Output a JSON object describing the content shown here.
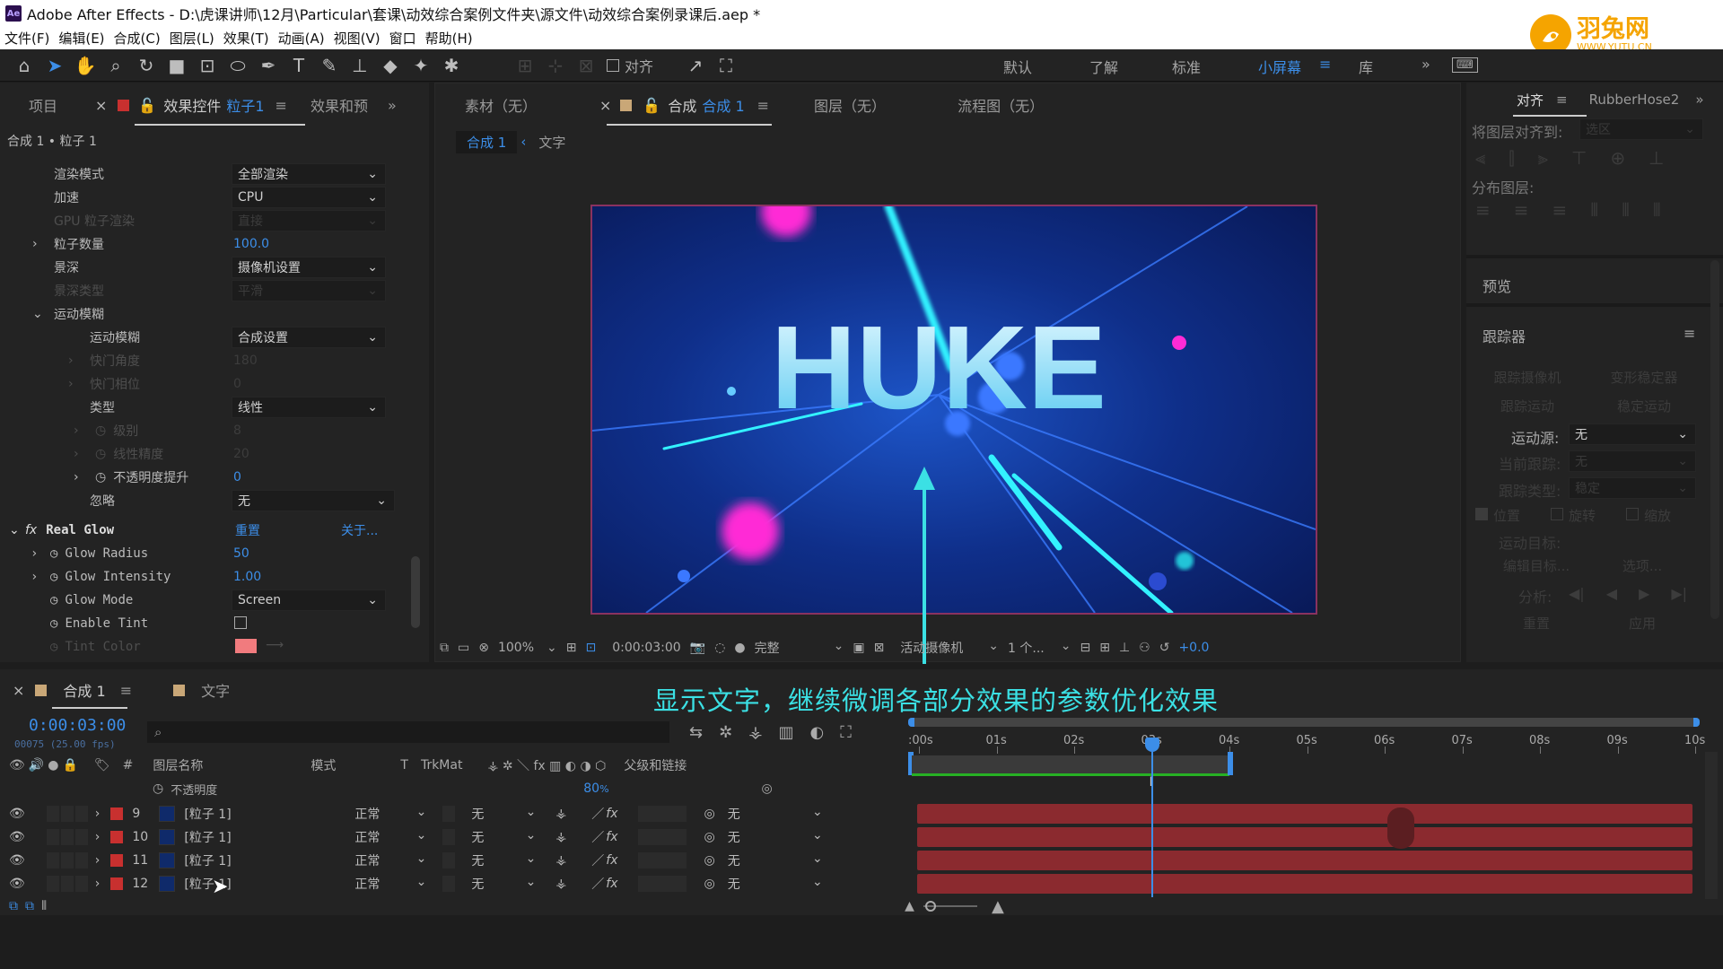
{
  "titlebar": {
    "app_icon": "Ae",
    "title": "Adobe After Effects - D:\\虎课讲师\\12月\\Particular\\套课\\动效综合案例文件夹\\源文件\\动效综合案例录课后.aep *"
  },
  "menu": [
    "文件(F)",
    "编辑(E)",
    "合成(C)",
    "图层(L)",
    "效果(T)",
    "动画(A)",
    "视图(V)",
    "窗口",
    "帮助(H)"
  ],
  "logo": {
    "name": "羽兔网",
    "url": "WWW.YUTU.CN",
    "color": "#f5a400"
  },
  "toolbar": {
    "align_label": "对齐",
    "workspaces": [
      "默认",
      "了解",
      "标准",
      "小屏幕",
      "库"
    ],
    "active_workspace": "小屏幕"
  },
  "left_panel": {
    "tabs": [
      "项目",
      "效果控件",
      "粒子1",
      "效果和预设"
    ],
    "tab_project": "项目",
    "tab_effects_prefix": "效果控件",
    "tab_effects_layer": "粒子1",
    "tab_presets": "效果和预",
    "breadcrumb": "合成 1 • 粒子 1",
    "rows": [
      {
        "label": "渲染模式",
        "value": "全部渲染",
        "type": "dropdown"
      },
      {
        "label": "加速",
        "value": "CPU",
        "type": "dropdown"
      },
      {
        "label": "GPU 粒子渲染",
        "value": "直接",
        "type": "dropdown-disabled"
      },
      {
        "label": "粒子数量",
        "value": "100.0",
        "type": "number"
      },
      {
        "label": "景深",
        "value": "摄像机设置",
        "type": "dropdown"
      },
      {
        "label": "景深类型",
        "value": "平滑",
        "type": "dropdown-disabled"
      },
      {
        "label": "运动模糊",
        "value": "",
        "type": "group"
      },
      {
        "label": "运动模糊",
        "value": "合成设置",
        "type": "dropdown"
      },
      {
        "label": "快门角度",
        "value": "180",
        "type": "number-disabled"
      },
      {
        "label": "快门相位",
        "value": "0",
        "type": "number-disabled"
      },
      {
        "label": "类型",
        "value": "线性",
        "type": "dropdown"
      },
      {
        "label": "级别",
        "value": "8",
        "type": "number-disabled"
      },
      {
        "label": "线性精度",
        "value": "20",
        "type": "number-disabled"
      },
      {
        "label": "不透明度提升",
        "value": "0",
        "type": "number"
      },
      {
        "label": "忽略",
        "value": "无",
        "type": "dropdown"
      }
    ],
    "effect": {
      "name": "Real Glow",
      "reset": "重置",
      "about": "关于...",
      "params": [
        {
          "label": "Glow Radius",
          "value": "50"
        },
        {
          "label": "Glow Intensity",
          "value": "1.00"
        },
        {
          "label": "Glow Mode",
          "value": "Screen"
        },
        {
          "label": "Enable Tint",
          "value": ""
        },
        {
          "label": "Tint Color",
          "value": ""
        }
      ]
    },
    "tint_color": "#f17b7e"
  },
  "comp_panel": {
    "tabs": [
      "素材（无）",
      "合成",
      "合成 1",
      "图层（无）",
      "流程图（无）"
    ],
    "tab_footage": "素材（无）",
    "tab_comp_prefix": "合成",
    "tab_comp_name": "合成 1",
    "tab_layer": "图层（无）",
    "tab_flow": "流程图（无）",
    "breadcrumb_active": "合成 1",
    "breadcrumb_next": "文字",
    "headline": "HUKE",
    "footer": {
      "zoom": "100%",
      "time": "0:00:03:00",
      "quality": "完整",
      "camera": "活动摄像机",
      "views": "1 个...",
      "exposure": "+0.0"
    }
  },
  "right_panel": {
    "align_tab": "对齐",
    "rubber_tab": "RubberHose2",
    "align_to_label": "将图层对齐到:",
    "align_to_value": "选区",
    "distribute_label": "分布图层:",
    "preview_label": "预览",
    "tracker_label": "跟踪器",
    "buttons": [
      "跟踪摄像机",
      "变形稳定器",
      "跟踪运动",
      "稳定运动"
    ],
    "motion_source_label": "运动源:",
    "motion_source_value": "无",
    "current_track_label": "当前跟踪:",
    "current_track_value": "无",
    "track_type_label": "跟踪类型:",
    "track_type_value": "稳定",
    "checks": [
      "位置",
      "旋转",
      "缩放"
    ],
    "motion_target_label": "运动目标:",
    "edit_target": "编辑目标...",
    "options": "选项...",
    "analyze_label": "分析:",
    "reset": "重置",
    "apply": "应用"
  },
  "timeline": {
    "tab_comp": "合成 1",
    "tab_text": "文字",
    "current_time": "0:00:03:00",
    "frame_info": "00075 (25.00 fps)",
    "subtitle": "显示文字，继续微调各部分效果的参数优化效果",
    "col_layer_name": "图层名称",
    "col_mode": "模式",
    "col_t": "T",
    "col_trkmat": "TrkMat",
    "col_parent": "父级和链接",
    "opacity_row": {
      "label": "不透明度",
      "value": "80",
      "unit": "%"
    },
    "ruler": [
      ":00s",
      "01s",
      "02s",
      "03s",
      "04s",
      "05s",
      "06s",
      "07s",
      "08s",
      "09s",
      "10s"
    ],
    "playhead_seconds": 3.0,
    "work_area_end_seconds": 4.0,
    "layers": [
      {
        "num": "9",
        "name": "[粒子 1]",
        "mode": "正常",
        "trkmat": "无",
        "parent": "无"
      },
      {
        "num": "10",
        "name": "[粒子 1]",
        "mode": "正常",
        "trkmat": "无",
        "parent": "无"
      },
      {
        "num": "11",
        "name": "[粒子 1]",
        "mode": "正常",
        "trkmat": "无",
        "parent": "无"
      },
      {
        "num": "12",
        "name": "[粒子 1]",
        "mode": "正常",
        "trkmat": "无",
        "parent": "无"
      }
    ],
    "layer_color": "#c8302f"
  }
}
